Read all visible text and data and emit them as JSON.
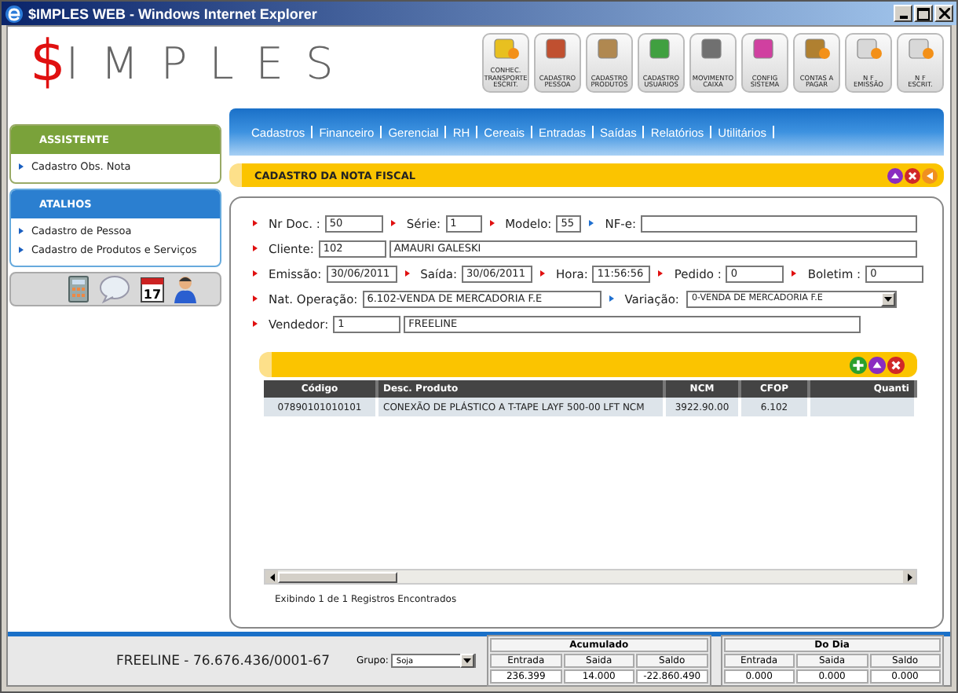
{
  "window": {
    "title": "$IMPLES WEB - Windows Internet Explorer"
  },
  "logo": {
    "symbol": "$",
    "text": "IMPLES"
  },
  "toolbar": [
    {
      "lines": [
        "CONHEC.",
        "TRANSPORTE",
        "ESCRIT."
      ]
    },
    {
      "lines": [
        "CADASTRO",
        "PESSOA"
      ]
    },
    {
      "lines": [
        "CADASTRO",
        "PRODUTOS"
      ]
    },
    {
      "lines": [
        "CADASTRO",
        "USUÁRIOS"
      ]
    },
    {
      "lines": [
        "MOVIMENTO",
        "CAIXA"
      ]
    },
    {
      "lines": [
        "CONFIG",
        "SISTEMA"
      ]
    },
    {
      "lines": [
        "CONTAS A",
        "PAGAR"
      ]
    },
    {
      "lines": [
        "N F",
        "EMISSÃO"
      ]
    },
    {
      "lines": [
        "N F",
        "ESCRIT."
      ]
    }
  ],
  "sidebar": {
    "panels": [
      {
        "title": "ASSISTENTE",
        "kind": "green",
        "items": [
          "Cadastro Obs. Nota"
        ]
      },
      {
        "title": "ATALHOS",
        "kind": "blue",
        "items": [
          "Cadastro de Pessoa",
          "Cadastro de Produtos e Serviços"
        ]
      }
    ],
    "calendar_day": "17"
  },
  "menu": [
    "Cadastros",
    "Financeiro",
    "Gerencial",
    "RH",
    "Cereais",
    "Entradas",
    "Saídas",
    "Relatórios",
    "Utilitários"
  ],
  "section_title": "CADASTRO DA NOTA FISCAL",
  "form": {
    "lines": [
      {
        "fields": [
          {
            "label": "Nr Doc. :",
            "required": true,
            "inputs": [
              {
                "kind": "short",
                "value": "50"
              }
            ]
          },
          {
            "label": "Série:",
            "required": true,
            "inputs": [
              {
                "kind": "tiny",
                "value": "1"
              }
            ]
          },
          {
            "label": "Modelo:",
            "required": true,
            "inputs": [
              {
                "kind": "micro",
                "value": "55"
              }
            ]
          },
          {
            "label": "NF-e:",
            "required": false,
            "inputs": [
              {
                "kind": "fill"
              }
            ]
          }
        ]
      },
      {
        "fields": [
          {
            "label": "Cliente:",
            "required": true,
            "inputs": [
              {
                "kind": "code",
                "value": "102"
              },
              {
                "kind": "fill",
                "value": "AMAURI GALESKI"
              }
            ]
          }
        ]
      },
      {
        "fields": [
          {
            "label": "Emissão:",
            "required": true,
            "inputs": [
              {
                "kind": "date",
                "value": "30/06/2011"
              }
            ]
          },
          {
            "label": "Saída:",
            "required": true,
            "inputs": [
              {
                "kind": "date",
                "value": "30/06/2011"
              }
            ]
          },
          {
            "label": "Hora:",
            "required": true,
            "inputs": [
              {
                "kind": "short",
                "value": "11:56:56"
              }
            ]
          },
          {
            "label": "Pedido :",
            "required": true,
            "inputs": [
              {
                "kind": "short",
                "value": "0"
              }
            ]
          },
          {
            "label": "Boletim :",
            "required": true,
            "inputs": [
              {
                "kind": "short",
                "value": "0"
              }
            ]
          }
        ]
      },
      {
        "fields": [
          {
            "label": "Nat. Operação:",
            "required": true,
            "inputs": [
              {
                "kind": "medium",
                "value": "6.102-VENDA DE MERCADORIA F.E"
              }
            ]
          },
          {
            "label": "Variação:",
            "required": false,
            "inputs": [
              {
                "kind": "select",
                "value": "0-VENDA DE MERCADORIA F.E"
              }
            ]
          }
        ]
      },
      {
        "fields": [
          {
            "label": "Vendedor:",
            "required": true,
            "inputs": [
              {
                "kind": "code",
                "value": "1"
              },
              {
                "kind": "name",
                "value": "FREELINE"
              }
            ]
          }
        ]
      }
    ]
  },
  "table": {
    "columns": [
      "Código",
      "Desc. Produto",
      "NCM",
      "CFOP",
      "Quanti"
    ],
    "rows": [
      [
        "07890101010101",
        "CONEXÃO DE PLÁSTICO A T-TAPE LAYF 500-00 LFT NCM",
        "3922.90.00",
        "6.102",
        ""
      ]
    ],
    "footer": "Exibindo 1 de 1 Registros Encontrados"
  },
  "status_bar": {
    "company": "FREELINE - 76.676.436/0001-67",
    "group_label": "Grupo:",
    "group_value": "Soja",
    "totals": [
      {
        "title": "Acumulado",
        "headers": [
          "Entrada",
          "Saida",
          "Saldo"
        ],
        "values": [
          "236.399",
          "14.000",
          "-22.860.490"
        ]
      },
      {
        "title": "Do Dia",
        "headers": [
          "Entrada",
          "Saida",
          "Saldo"
        ],
        "values": [
          "0.000",
          "0.000",
          "0.000"
        ]
      }
    ]
  }
}
